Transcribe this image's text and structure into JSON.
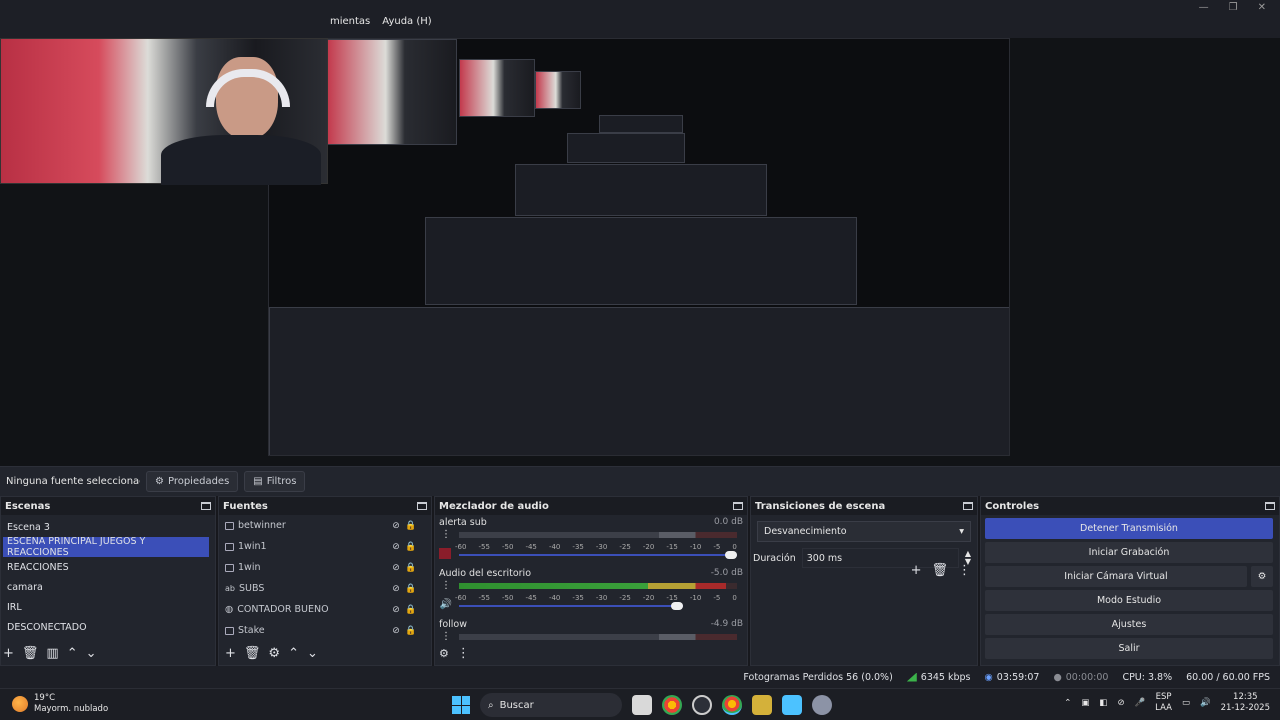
{
  "menu": {
    "items": [
      "mientas",
      "Ayuda (H)"
    ]
  },
  "preview": {
    "nested_menu": "mientas Ayuda (H)"
  },
  "props_bar": {
    "no_selection": "Ninguna fuente seleccionac",
    "properties": "Propiedades",
    "filters": "Filtros"
  },
  "scenes": {
    "title": "Escenas",
    "items": [
      "Escena 3",
      "ESCENA PRINCIPAL JUEGOS Y REACCIONES",
      "REACCIONES",
      "camara",
      "IRL",
      "DESCONECTADO"
    ],
    "selected_index": 1
  },
  "sources": {
    "title": "Fuentes",
    "items": [
      "betwinner",
      "1win1",
      "1win",
      "SUBS",
      "CONTADOR BUENO",
      "Stake"
    ]
  },
  "mixer": {
    "title": "Mezclador de audio",
    "channels": [
      {
        "name": "alerta sub",
        "db": "0.0 dB",
        "level": 0.0,
        "muted": true
      },
      {
        "name": "Audio del escritorio",
        "db": "-5.0 dB",
        "level": 0.92,
        "muted": false
      },
      {
        "name": "follow",
        "db": "-4.9 dB",
        "level": 0.0,
        "muted": false
      }
    ],
    "ticks": [
      "-60",
      "-55",
      "-50",
      "-45",
      "-40",
      "-35",
      "-30",
      "-25",
      "-20",
      "-15",
      "-10",
      "-5",
      "0"
    ]
  },
  "transitions": {
    "title": "Transiciones de escena",
    "selected": "Desvanecimiento",
    "duration_label": "Duración",
    "duration_value": "300 ms"
  },
  "controls": {
    "title": "Controles",
    "stop_stream": "Detener Transmisión",
    "start_recording": "Iniciar Grabación",
    "start_virtual_cam": "Iniciar Cámara Virtual",
    "studio_mode": "Modo Estudio",
    "settings": "Ajustes",
    "exit": "Salir"
  },
  "status": {
    "dropped_frames": "Fotogramas Perdidos 56 (0.0%)",
    "bitrate": "6345 kbps",
    "stream_time": "03:59:07",
    "rec_time": "00:00:00",
    "cpu": "CPU: 3.8%",
    "fps": "60.00 / 60.00 FPS"
  },
  "taskbar": {
    "temperature": "19°C",
    "weather": "Mayorm. nublado",
    "search": "Buscar",
    "lang_top": "ESP",
    "lang_bottom": "LAA",
    "time": "12:35",
    "date": "21-12-2025"
  },
  "colors": {
    "accent": "#3b4fb8",
    "panel": "#22252d",
    "background": "#1d1f26",
    "meter_green": "#3aa03a",
    "meter_yellow": "#b5a034",
    "meter_red": "#a82a2a"
  }
}
